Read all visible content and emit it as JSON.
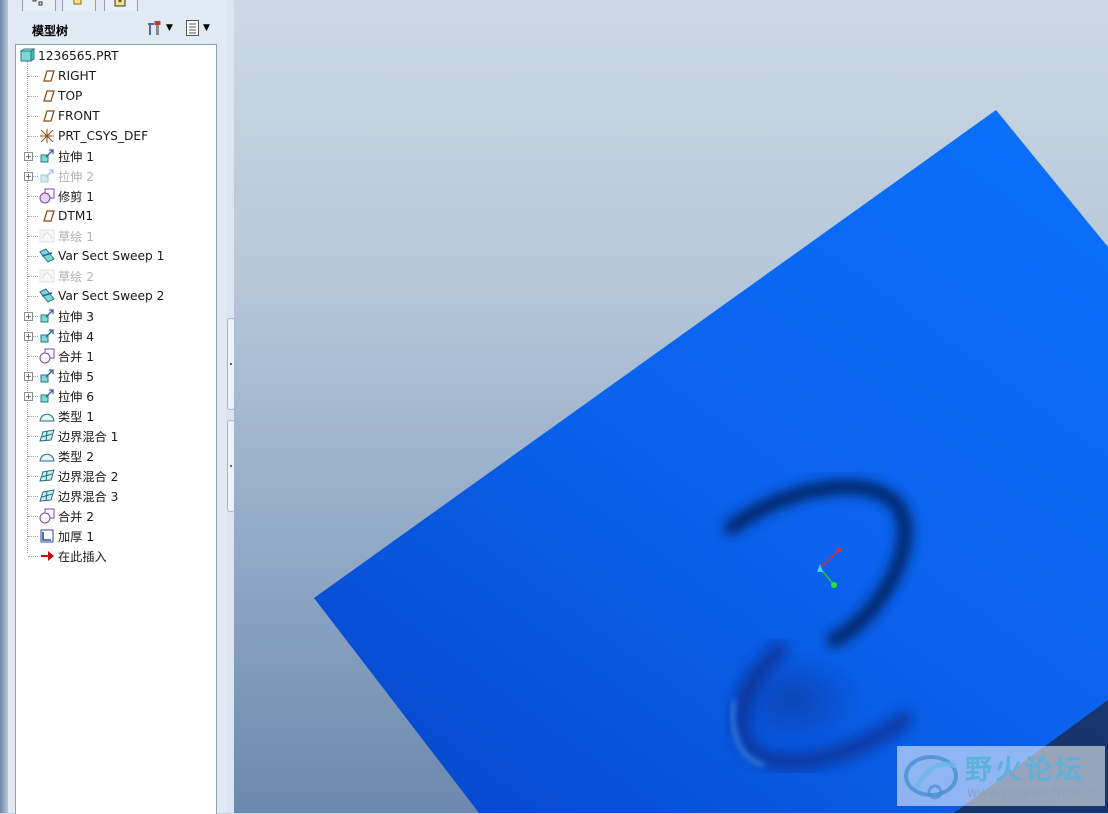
{
  "panel": {
    "title": "模型树",
    "tabs": [
      "model-tree-tab",
      "layers-tab",
      "favorites-tab"
    ]
  },
  "tree": {
    "root": "1236565.PRT",
    "items": [
      {
        "label": "RIGHT",
        "icon": "datum-plane-icon",
        "expandable": false,
        "dimmed": false
      },
      {
        "label": "TOP",
        "icon": "datum-plane-icon",
        "expandable": false,
        "dimmed": false
      },
      {
        "label": "FRONT",
        "icon": "datum-plane-icon",
        "expandable": false,
        "dimmed": false
      },
      {
        "label": "PRT_CSYS_DEF",
        "icon": "coordinate-system-icon",
        "expandable": false,
        "dimmed": false
      },
      {
        "label": "拉伸 1",
        "icon": "extrude-icon",
        "expandable": true,
        "dimmed": false
      },
      {
        "label": "拉伸 2",
        "icon": "extrude-icon",
        "expandable": true,
        "dimmed": true
      },
      {
        "label": "修剪 1",
        "icon": "trim-icon",
        "expandable": false,
        "dimmed": false
      },
      {
        "label": "DTM1",
        "icon": "datum-plane-icon",
        "expandable": false,
        "dimmed": false
      },
      {
        "label": "草绘 1",
        "icon": "sketch-icon",
        "expandable": false,
        "dimmed": true
      },
      {
        "label": "Var Sect Sweep 1",
        "icon": "variable-section-sweep-icon",
        "expandable": false,
        "dimmed": false
      },
      {
        "label": "草绘 2",
        "icon": "sketch-icon",
        "expandable": false,
        "dimmed": true
      },
      {
        "label": "Var Sect Sweep 2",
        "icon": "variable-section-sweep-icon",
        "expandable": false,
        "dimmed": false
      },
      {
        "label": "拉伸 3",
        "icon": "extrude-icon",
        "expandable": true,
        "dimmed": false
      },
      {
        "label": "拉伸 4",
        "icon": "extrude-icon",
        "expandable": true,
        "dimmed": false
      },
      {
        "label": "合并 1",
        "icon": "merge-icon",
        "expandable": false,
        "dimmed": false
      },
      {
        "label": "拉伸 5",
        "icon": "extrude-icon",
        "expandable": true,
        "dimmed": false
      },
      {
        "label": "拉伸 6",
        "icon": "extrude-icon",
        "expandable": true,
        "dimmed": false
      },
      {
        "label": "类型 1",
        "icon": "style-surface-icon",
        "expandable": false,
        "dimmed": false
      },
      {
        "label": "边界混合 1",
        "icon": "boundary-blend-icon",
        "expandable": false,
        "dimmed": false
      },
      {
        "label": "类型 2",
        "icon": "style-surface-icon",
        "expandable": false,
        "dimmed": false
      },
      {
        "label": "边界混合 2",
        "icon": "boundary-blend-icon",
        "expandable": false,
        "dimmed": false
      },
      {
        "label": "边界混合 3",
        "icon": "boundary-blend-icon",
        "expandable": false,
        "dimmed": false
      },
      {
        "label": "合并 2",
        "icon": "merge-icon",
        "expandable": false,
        "dimmed": false
      },
      {
        "label": "加厚 1",
        "icon": "thicken-icon",
        "expandable": false,
        "dimmed": false
      },
      {
        "label": "在此插入",
        "icon": "insert-here-arrow-icon",
        "expandable": false,
        "dimmed": false
      }
    ]
  },
  "viewport": {
    "model_color": "#0a6fff",
    "background_top": "#cbd9e6",
    "background_bottom": "#6c88ae"
  },
  "watermark": {
    "title": "野火论坛",
    "url": "www.proewildfire.cn"
  }
}
